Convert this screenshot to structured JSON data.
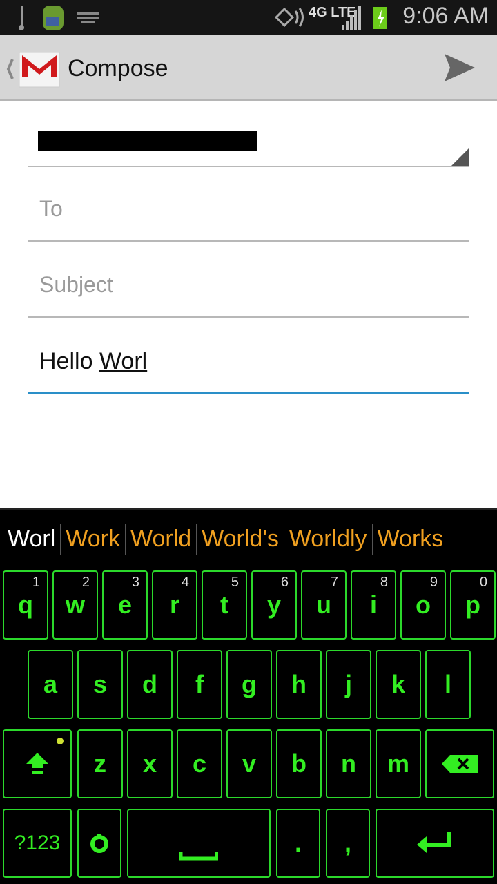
{
  "status_bar": {
    "time": "9:06 AM",
    "network": "4G LTE",
    "icons": [
      "usb-icon",
      "android-icon",
      "keyboard-icon",
      "nfc-icon",
      "signal-icon",
      "battery-charging-icon"
    ]
  },
  "app_bar": {
    "title": "Compose",
    "icons": [
      "back-icon",
      "gmail-icon",
      "send-icon"
    ]
  },
  "form": {
    "from_value": "[redacted]",
    "to_placeholder": "To",
    "subject_placeholder": "Subject",
    "body_text": "Hello ",
    "body_composing": "Worl"
  },
  "keyboard": {
    "suggestions": [
      "Worl",
      "Work",
      "World",
      "World's",
      "Worldly",
      "Works"
    ],
    "row1": [
      [
        "q",
        "1"
      ],
      [
        "w",
        "2"
      ],
      [
        "e",
        "3"
      ],
      [
        "r",
        "4"
      ],
      [
        "t",
        "5"
      ],
      [
        "y",
        "6"
      ],
      [
        "u",
        "7"
      ],
      [
        "i",
        "8"
      ],
      [
        "o",
        "9"
      ],
      [
        "p",
        "0"
      ]
    ],
    "row2": [
      "a",
      "s",
      "d",
      "f",
      "g",
      "h",
      "j",
      "k",
      "l"
    ],
    "row3": [
      "z",
      "x",
      "c",
      "v",
      "b",
      "n",
      "m"
    ],
    "symbols_label": "?123",
    "period": ".",
    "comma": ",",
    "colors": {
      "key_text": "#33ee22",
      "suggestion": "#f0a020"
    }
  }
}
